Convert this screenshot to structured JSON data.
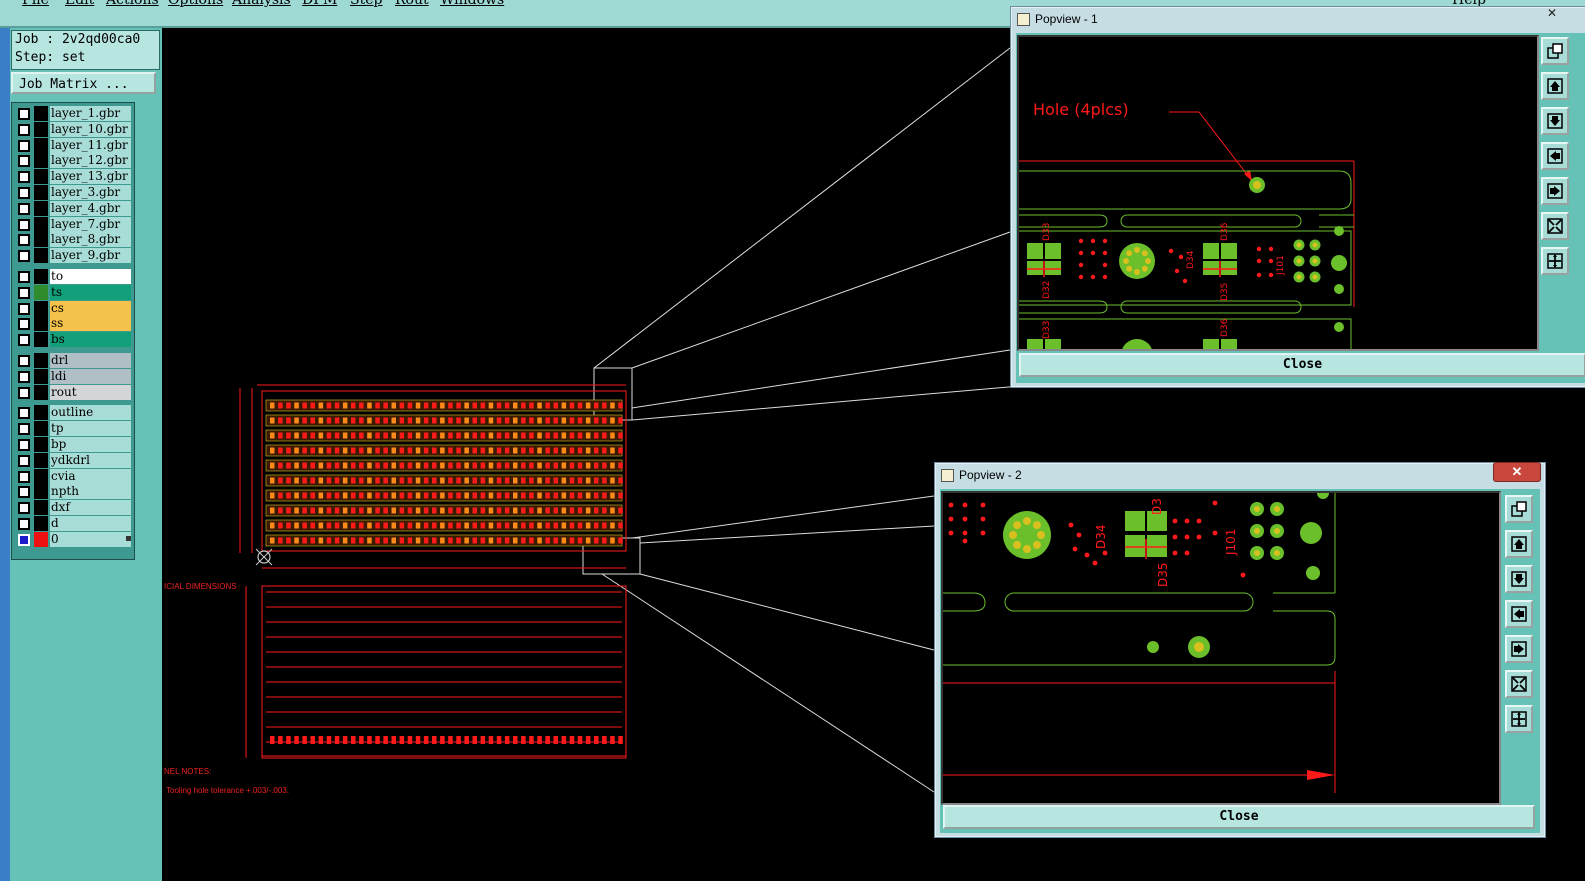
{
  "menu": {
    "items": [
      "File",
      "Edit",
      "Actions",
      "Options",
      "Analysis",
      "DFM",
      "Step",
      "Rout",
      "Windows"
    ],
    "help": "Help"
  },
  "job": {
    "job_label": "Job : 2v2qd00ca0",
    "step_label": "Step: set"
  },
  "job_matrix_label": "Job Matrix ...",
  "layers": [
    {
      "name": "layer_1.gbr",
      "color": "#000000",
      "bg": "#a8dcd7",
      "checked": false
    },
    {
      "name": "layer_10.gbr",
      "color": "#000000",
      "bg": "#a8dcd7",
      "checked": false
    },
    {
      "name": "layer_11.gbr",
      "color": "#000000",
      "bg": "#a8dcd7",
      "checked": false
    },
    {
      "name": "layer_12.gbr",
      "color": "#000000",
      "bg": "#a8dcd7",
      "checked": false
    },
    {
      "name": "layer_13.gbr",
      "color": "#000000",
      "bg": "#a8dcd7",
      "checked": false
    },
    {
      "name": "layer_3.gbr",
      "color": "#000000",
      "bg": "#a8dcd7",
      "checked": false
    },
    {
      "name": "layer_4.gbr",
      "color": "#000000",
      "bg": "#a8dcd7",
      "checked": false
    },
    {
      "name": "layer_7.gbr",
      "color": "#000000",
      "bg": "#a8dcd7",
      "checked": false
    },
    {
      "name": "layer_8.gbr",
      "color": "#000000",
      "bg": "#a8dcd7",
      "checked": false
    },
    {
      "name": "layer_9.gbr",
      "color": "#000000",
      "bg": "#a8dcd7",
      "checked": false
    },
    {
      "name": "to",
      "color": "#000000",
      "bg": "#ffffff",
      "checked": false
    },
    {
      "name": "ts",
      "color": "#2e8b2e",
      "bg": "#12a07a",
      "checked": false
    },
    {
      "name": "cs",
      "color": "#000000",
      "bg": "#f4c24a",
      "checked": false
    },
    {
      "name": "ss",
      "color": "#000000",
      "bg": "#f4c24a",
      "checked": false
    },
    {
      "name": "bs",
      "color": "#000000",
      "bg": "#12a07a",
      "checked": false
    },
    {
      "name": "drl",
      "color": "#000000",
      "bg": "#b0bfc6",
      "checked": false
    },
    {
      "name": "ldi",
      "color": "#000000",
      "bg": "#b0bfc6",
      "checked": false
    },
    {
      "name": "rout",
      "color": "#000000",
      "bg": "#d2d6d8",
      "checked": false
    },
    {
      "name": "outline",
      "color": "#000000",
      "bg": "#a8dcd7",
      "checked": false
    },
    {
      "name": "tp",
      "color": "#000000",
      "bg": "#a8dcd7",
      "checked": false
    },
    {
      "name": "bp",
      "color": "#000000",
      "bg": "#a8dcd7",
      "checked": false
    },
    {
      "name": "ydkdrl",
      "color": "#000000",
      "bg": "#a8dcd7",
      "checked": false
    },
    {
      "name": "cvia",
      "color": "#000000",
      "bg": "#a8dcd7",
      "checked": false
    },
    {
      "name": "npth",
      "color": "#000000",
      "bg": "#a8dcd7",
      "checked": false
    },
    {
      "name": "dxf",
      "color": "#000000",
      "bg": "#a8dcd7",
      "checked": false
    },
    {
      "name": "d",
      "color": "#000000",
      "bg": "#a8dcd7",
      "checked": false
    },
    {
      "name": "0",
      "color": "#ee1111",
      "bg": "#a8dcd7",
      "checked": true
    }
  ],
  "drawing": {
    "dimension_note": "ICIAL DIMENSIONS",
    "panel_notes_title": "NEL NOTES:",
    "panel_note_1": "Tooling hole tolerance +.003/-.003."
  },
  "popview1": {
    "title": "Popview - 1",
    "close_label": "Close",
    "annotation": "Hole (4plcs)",
    "labels": [
      "D33",
      "D36",
      "D34",
      "J101",
      "D32",
      "D35",
      "D33",
      "D36"
    ]
  },
  "popview2": {
    "title": "Popview - 2",
    "close_label": "Close",
    "labels": [
      "D3",
      "D34",
      "D35",
      "J101"
    ]
  },
  "colors": {
    "board_red": "#ff1a1a",
    "pad_green": "#6bbf2a",
    "pad_yellow": "#d8c01e",
    "panel_bg": "#66c2b7"
  },
  "icons": {
    "toolbar": [
      "zoom-fit-icon",
      "pan-up-icon",
      "pan-down-icon",
      "pan-left-icon",
      "pan-right-icon",
      "zoom-out-icon",
      "zoom-in-icon"
    ]
  }
}
